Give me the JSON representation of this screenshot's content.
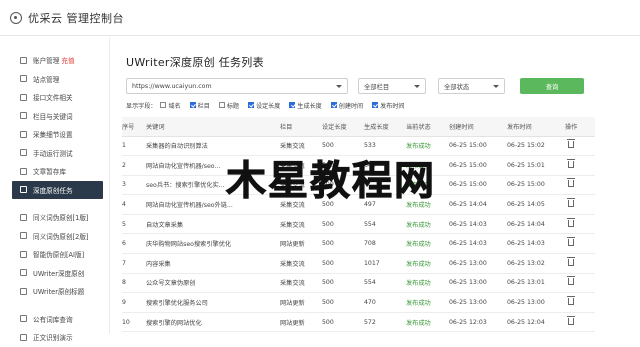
{
  "header": {
    "title": "优采云 管理控制台",
    "logo_icon": "gear-circle-icon"
  },
  "sidebar": {
    "items": [
      {
        "label": "账户管理",
        "hot": "充值",
        "icon": "chart-icon"
      },
      {
        "label": "站点管理",
        "icon": "site-icon"
      },
      {
        "label": "接口文件相关",
        "icon": "interface-icon"
      },
      {
        "label": "栏目与关键词",
        "icon": "list-icon"
      },
      {
        "label": "采集细节设置",
        "icon": "settings-icon"
      },
      {
        "label": "手动运行测试",
        "icon": "play-icon"
      },
      {
        "label": "文章暂存库",
        "icon": "folder-icon"
      },
      {
        "label": "深度原创任务",
        "icon": "edit-icon",
        "active": true
      },
      {
        "label": "同义词伪原创[1版]",
        "icon": "sync-icon"
      },
      {
        "label": "同义词伪原创[2版]",
        "icon": "sync-icon"
      },
      {
        "label": "智能伪原创[AI版]",
        "icon": "sync-icon"
      },
      {
        "label": "UWriter深度原创",
        "icon": "pen-icon"
      },
      {
        "label": "UWriter原创标题",
        "icon": "pen-icon"
      },
      {
        "label": "公有词库查询",
        "icon": "book-icon"
      },
      {
        "label": "正文识别演示",
        "icon": "doc-icon"
      }
    ]
  },
  "main": {
    "title": "UWriter深度原创 任务列表",
    "url_select": "https://www.ucaiyun.com",
    "category_select": "全部栏目",
    "status_select": "全部状态",
    "query_button": "查询",
    "fields_label": "显示字段：",
    "fields": [
      {
        "label": "域名",
        "checked": false
      },
      {
        "label": "栏目",
        "checked": true
      },
      {
        "label": "标题",
        "checked": false
      },
      {
        "label": "设定长度",
        "checked": true
      },
      {
        "label": "生成长度",
        "checked": true
      },
      {
        "label": "创建时间",
        "checked": true
      },
      {
        "label": "发布时间",
        "checked": true
      }
    ],
    "columns": [
      "序号",
      "关键词",
      "栏目",
      "设定长度",
      "生成长度",
      "当前状态",
      "创建时间",
      "发布时间",
      "操作"
    ],
    "rows": [
      [
        "1",
        "采集器的自动识别算法",
        "采集交流",
        "500",
        "533",
        "发布成功",
        "06-25 15:00",
        "06-25 15:02"
      ],
      [
        "2",
        "网站自动化宣传机器/seo...",
        "采集交流",
        "500",
        "642",
        "发布成功",
        "06-25 15:00",
        "06-25 15:01"
      ],
      [
        "3",
        "seo兵书：搜索引擎优化实...",
        "采集交流",
        "500",
        "",
        "发布成功",
        "06-25 15:00",
        "06-25 15:00"
      ],
      [
        "4",
        "网站自动化宣传机器/seo外链...",
        "采集交流",
        "500",
        "497",
        "发布成功",
        "06-25 14:04",
        "06-25 14:05"
      ],
      [
        "5",
        "自动文章采集",
        "采集交流",
        "500",
        "554",
        "发布成功",
        "06-25 14:03",
        "06-25 14:04"
      ],
      [
        "6",
        "庆华购物网站seo搜索引擎优化",
        "网站更新",
        "500",
        "708",
        "发布成功",
        "06-25 14:03",
        "06-25 14:03"
      ],
      [
        "7",
        "内容采集",
        "采集交流",
        "500",
        "1017",
        "发布成功",
        "06-25 13:00",
        "06-25 13:02"
      ],
      [
        "8",
        "公众号文章伪原创",
        "采集交流",
        "500",
        "554",
        "发布成功",
        "06-25 13:00",
        "06-25 13:01"
      ],
      [
        "9",
        "搜索引擎优化服务公司",
        "网站更新",
        "500",
        "470",
        "发布成功",
        "06-25 13:00",
        "06-25 13:00"
      ],
      [
        "10",
        "搜索引擎的网站优化",
        "网站更新",
        "500",
        "572",
        "发布成功",
        "06-25 12:03",
        "06-25 12:04"
      ]
    ]
  },
  "watermark": "木星教程网",
  "colors": {
    "sidebar_active": "#2b3a4a",
    "query_button": "#5cb85c",
    "status_ok": "#3a9a3a",
    "hot": "#e53935"
  }
}
